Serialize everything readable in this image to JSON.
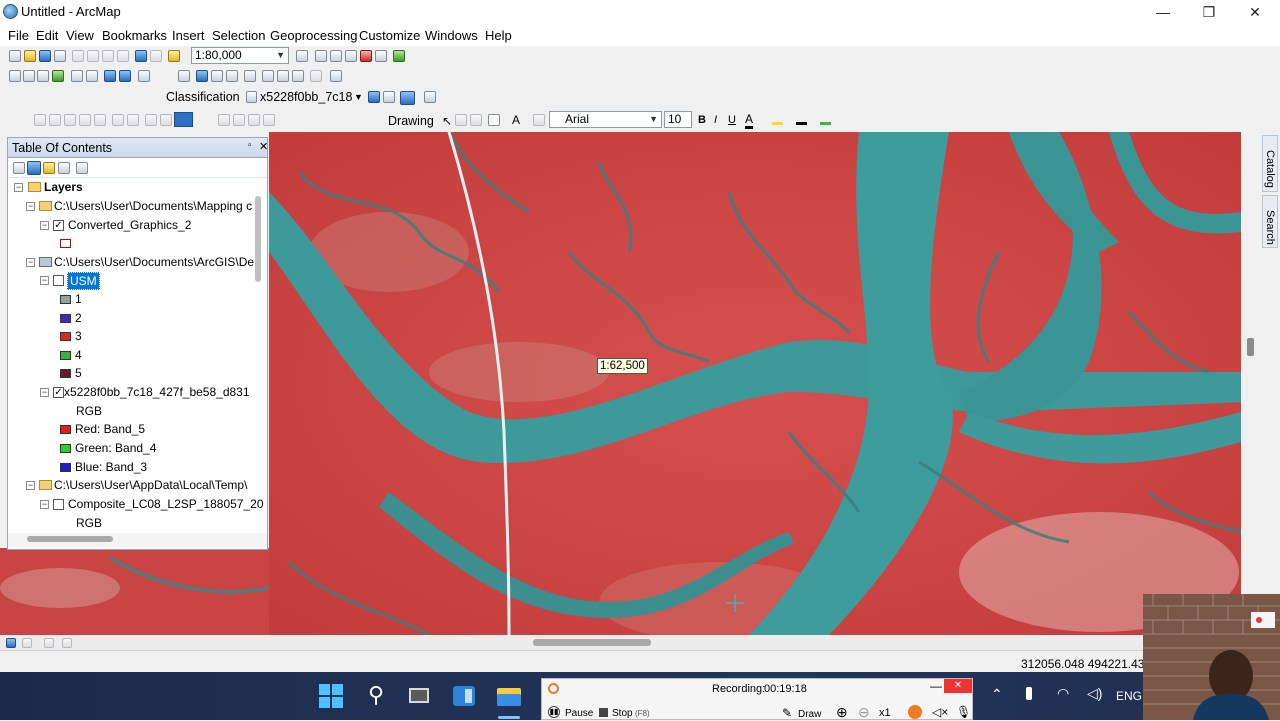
{
  "window": {
    "title": "Untitled - ArcMap",
    "controls": {
      "minimize": "—",
      "maximize": "❐",
      "close": "✕"
    }
  },
  "menu": [
    "File",
    "Edit",
    "View",
    "Bookmarks",
    "Insert",
    "Selection",
    "Geoprocessing",
    "Customize",
    "Windows",
    "Help"
  ],
  "toolbars": {
    "scale": "1:80,000",
    "classification_label": "Classification",
    "classification_layer": "x5228f0bb_7c18",
    "drawing_label": "Drawing",
    "font_name": "Arial",
    "font_size": "10",
    "bold": "B",
    "italic": "I",
    "underline": "U",
    "text_color_glyph": "A"
  },
  "side_tabs": {
    "catalog": "Catalog",
    "search": "Search"
  },
  "toc": {
    "title": "Table Of Contents",
    "layers_label": "Layers",
    "items": [
      {
        "label": "C:\\Users\\User\\Documents\\Mapping c"
      },
      {
        "label": "Converted_Graphics_2"
      },
      {
        "label": "C:\\Users\\User\\Documents\\ArcGIS\\De"
      },
      {
        "label": "USM"
      },
      {
        "label": "1",
        "color": "#8fa59b"
      },
      {
        "label": "2",
        "color": "#3a2fb0"
      },
      {
        "label": "3",
        "color": "#d22a2a"
      },
      {
        "label": "4",
        "color": "#3bb03a"
      },
      {
        "label": "5",
        "color": "#6a1a2a"
      },
      {
        "label": "x5228f0bb_7c18_427f_be58_d831"
      },
      {
        "label": "RGB"
      },
      {
        "label": "Red:    Band_5",
        "color": "#e01c1c"
      },
      {
        "label": "Green: Band_4",
        "color": "#2bd12b"
      },
      {
        "label": "Blue:   Band_3",
        "color": "#1b1bd0"
      },
      {
        "label": "C:\\Users\\User\\AppData\\Local\\Temp\\"
      },
      {
        "label": "Composite_LC08_L2SP_188057_20"
      },
      {
        "label": "RGB"
      }
    ]
  },
  "map": {
    "scale_tooltip": "1:62,500"
  },
  "status": {
    "coordinates": "312056.048  494221.43"
  },
  "recorder": {
    "recording_label": "Recording:",
    "elapsed": "00:19:18",
    "pause": "Pause",
    "stop": "Stop",
    "stop_key": "(F8)",
    "draw": "Draw",
    "zoom": "x1"
  },
  "taskbar": {
    "language": "ENG"
  }
}
